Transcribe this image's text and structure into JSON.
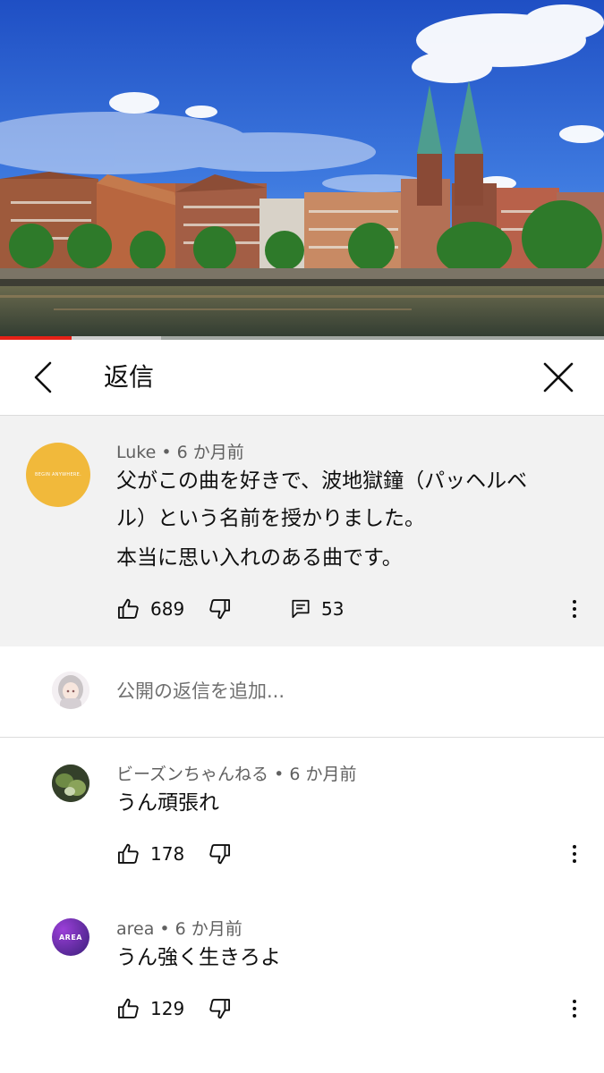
{
  "video": {
    "progress_played": 0.118,
    "progress_buffered": 0.267
  },
  "header": {
    "title": "返信"
  },
  "main_comment": {
    "author": "Luke",
    "time": "6 か月前",
    "avatar_text": "BEGIN ANYWHERE.",
    "lines": [
      "父がこの曲を好きで、波地獄鐘（パッヘルベ",
      "ル）という名前を授かりました。",
      "本当に思い入れのある曲です。"
    ],
    "likes": "689",
    "replies": "53"
  },
  "add_reply": {
    "placeholder": "公開の返信を追加..."
  },
  "replies": [
    {
      "author": "ビーズンちゃんねる",
      "time": "6 か月前",
      "text": "うん頑張れ",
      "likes": "178"
    },
    {
      "author": "area",
      "time": "6 か月前",
      "text": "うん強く生きろよ",
      "likes": "129",
      "avatar_text": "AREA"
    }
  ],
  "colors": {
    "progress": "#e62117",
    "luke_avatar": "#f1b93b",
    "area_avatar": "#5b2fa0"
  }
}
